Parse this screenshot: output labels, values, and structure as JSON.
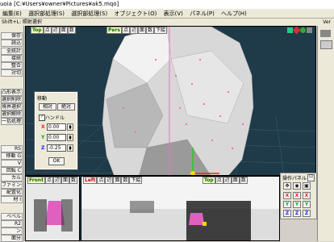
{
  "window": {
    "title": "uoia [C:¥Users¥owner¥Pictures¥ak5.mqo]"
  },
  "menu": [
    "編集(E)",
    "選択部処理(S)",
    "選択部処理(S)",
    "オブジェクト(O)",
    "表示(V)",
    "パネル(P)",
    "ヘルプ(H)"
  ],
  "shortcut_hint": "Shift+L: 照射選択",
  "version": "Ver",
  "left_tools": [
    "保存",
    "読込",
    "全統計",
    "接続",
    "整合",
    "対切",
    "凸形表示",
    "選択削除",
    "境界選択",
    "選択解除",
    "一括処理",
    "RS",
    "移動 G",
    "V",
    "回転 C",
    "カル",
    "ファミング",
    "配置化",
    "材 I",
    "ベベル",
    "R2",
    "ン",
    "面分",
    "オ"
  ],
  "top_view": {
    "label": "Top",
    "tools": [
      "点",
      "辺",
      "面",
      "数"
    ]
  },
  "persp_view": {
    "label": "Pers",
    "tools": [
      "点",
      "辺",
      "面",
      "数",
      "下絵"
    ]
  },
  "front_view": {
    "label": "Front",
    "tools": [
      "点",
      "辺",
      "面",
      "数"
    ]
  },
  "left_view": {
    "label": "Left",
    "tools": [
      "点",
      "辺",
      "面",
      "数",
      "下絵"
    ]
  },
  "top_right_view": {
    "label": "Top",
    "tools": [
      "点",
      "辺",
      "面",
      "数"
    ]
  },
  "move_dialog": {
    "title": "移動",
    "tab_relative": "相対",
    "tab_absolute": "絶対",
    "handle_label": "ハンドル",
    "x": {
      "label": "X",
      "value": "0.00"
    },
    "y": {
      "label": "Y",
      "value": "0.00"
    },
    "z": {
      "label": "Z",
      "value": "-0.25"
    },
    "ok_label": "OK"
  },
  "control_panel": {
    "title": "操作パネル",
    "close_label": "ロ",
    "x_label": "X",
    "y_label": "Y",
    "z_label": "Z"
  },
  "colors": {
    "viewport_bg": "#1f3a48",
    "selection": "#ff66c4",
    "axis_x": "#ee2222",
    "axis_y": "#22cc22",
    "axis_z": "#2233ff"
  }
}
